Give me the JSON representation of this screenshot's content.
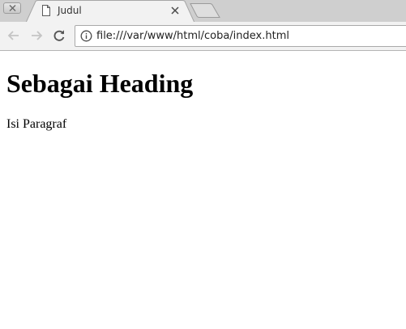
{
  "browser": {
    "tab": {
      "title": "Judul",
      "favicon": "page-icon",
      "close_icon": "close-icon"
    },
    "new_tab_icon": "new-tab-icon",
    "window_close_icon": "close-icon",
    "toolbar": {
      "back_icon": "arrow-left-icon",
      "forward_icon": "arrow-right-icon",
      "reload_icon": "reload-icon",
      "site_info_icon": "info-icon",
      "url": "file:///var/www/html/coba/index.html"
    }
  },
  "page": {
    "heading": "Sebagai Heading",
    "paragraph": "Isi Paragraf"
  }
}
